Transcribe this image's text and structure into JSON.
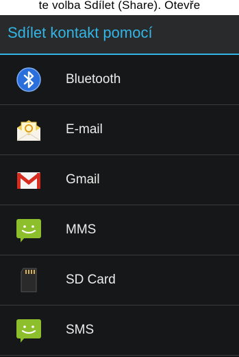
{
  "page_caption": "te volba Sdílet (Share). Otevře",
  "dialog": {
    "title": "Sdílet kontakt pomocí",
    "accent_color": "#33b5e5",
    "items": [
      {
        "label": "Bluetooth",
        "icon": "bluetooth-icon"
      },
      {
        "label": "E-mail",
        "icon": "email-icon"
      },
      {
        "label": "Gmail",
        "icon": "gmail-icon"
      },
      {
        "label": "MMS",
        "icon": "mms-icon"
      },
      {
        "label": "SD Card",
        "icon": "sd-card-icon"
      },
      {
        "label": "SMS",
        "icon": "sms-icon"
      }
    ]
  }
}
